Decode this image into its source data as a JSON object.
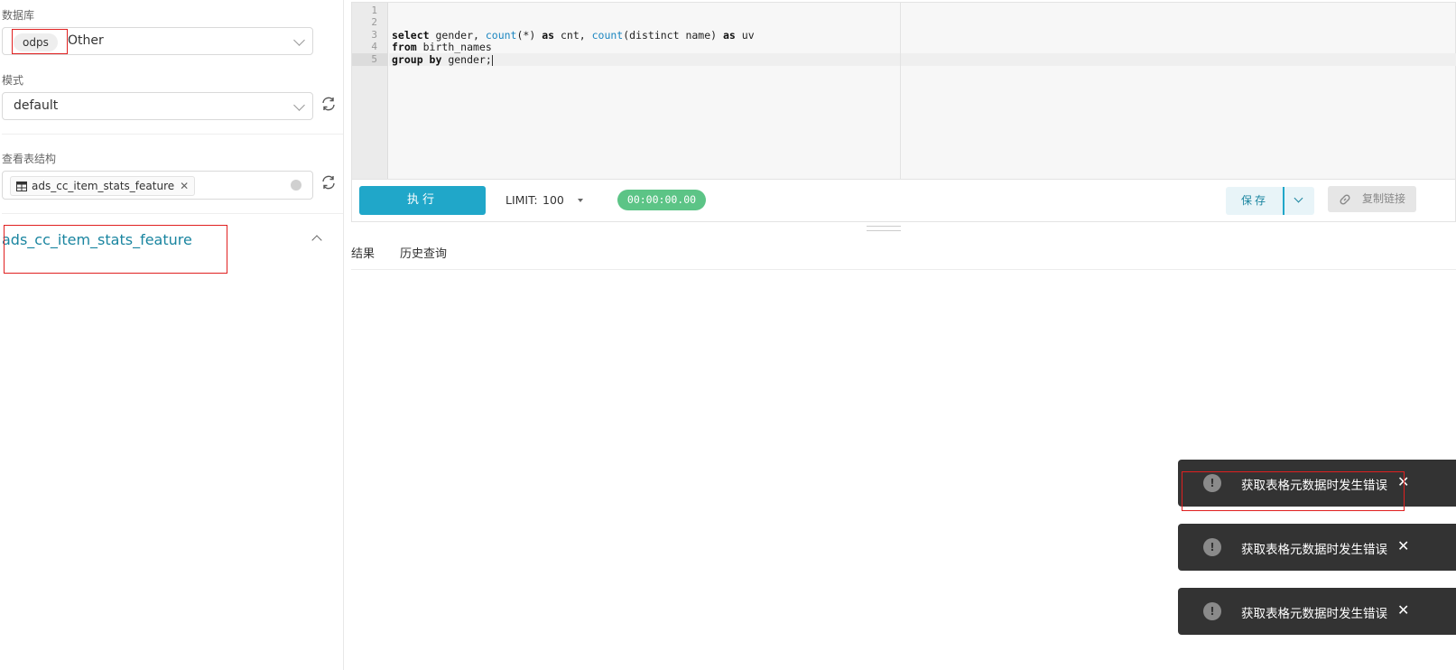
{
  "sidebar": {
    "database_label": "数据库",
    "database_tag": "odps",
    "database_value": "Other",
    "schema_label": "模式",
    "schema_value": "default",
    "table_label": "查看表结构",
    "table_tag": "ads_cc_item_stats_feature",
    "table_title": "ads_cc_item_stats_feature"
  },
  "editor": {
    "line_numbers": [
      "1",
      "2",
      "3",
      "4",
      "5"
    ],
    "code": {
      "l3_kw1": "select",
      "l3_t1": " gender, ",
      "l3_fn1": "count",
      "l3_t2": "(*) ",
      "l3_kw2": "as",
      "l3_t3": " cnt, ",
      "l3_fn2": "count",
      "l3_t4": "(distinct name) ",
      "l3_kw3": "as",
      "l3_t5": " uv",
      "l4_kw": "from",
      "l4_t": " birth_names",
      "l5_kw": "group by",
      "l5_t": " gender;"
    }
  },
  "toolbar": {
    "run_label": "执行",
    "limit_label": "LIMIT:",
    "limit_value": "100",
    "timer": "00:00:00.00",
    "save_label": "保存",
    "copy_link_label": "复制链接"
  },
  "results": {
    "tabs": [
      "结果",
      "历史查询"
    ]
  },
  "toasts": [
    {
      "message": "获取表格元数据时发生错误"
    },
    {
      "message": "获取表格元数据时发生错误"
    },
    {
      "message": "获取表格元数据时发生错误"
    }
  ],
  "colors": {
    "accent": "#20a7c9",
    "timer": "#5cc486",
    "toast_bg": "#333333",
    "annotation": "#e02020"
  }
}
